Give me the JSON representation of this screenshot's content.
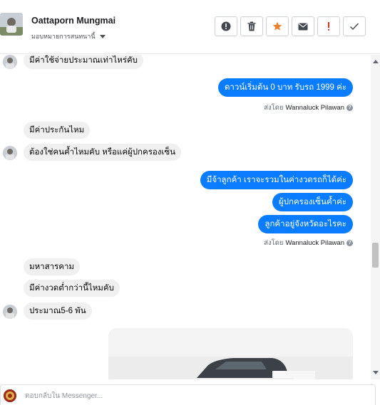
{
  "header": {
    "name": "Oattaporn Mungmai",
    "assign_label": "มอบหมายการสนทนานี้"
  },
  "actions": [
    {
      "icon": "alert-circle-icon"
    },
    {
      "icon": "trash-icon"
    },
    {
      "icon": "star-icon",
      "color": "#e8812d"
    },
    {
      "icon": "envelope-icon"
    },
    {
      "icon": "exclamation-icon",
      "color": "#d93025"
    },
    {
      "icon": "checkmark-icon"
    }
  ],
  "messages": {
    "m1": "มีค่าใช้จ่ายประมาณเท่าไหร่คับ",
    "m2": "ดาวน์เริ่มต้น 0 บาท รับรถ 1999 ค่ะ",
    "sent_prefix": "ส่งโดย",
    "sender": "Wannaluck Pilawan",
    "m3": "มีค่าประกันไหม",
    "m4": "ต้องใช่คนค้ำไหมคับ หรือแค่ผู้ปกครองเซ็น",
    "m5": "มีจ้าลูกค้า  เราจะรวมในค่างวดรถก็ได้ค่ะ",
    "m6": "ผู้ปกครองเซ็นค้ำค่ะ",
    "m7": "ลูกค้าอยู่จังหวัดอะไรคะ",
    "m8": "มหาสารคาม",
    "m9": "มีค่างวดต่ำกว่านี้ไหมคับ",
    "m10": "ประมาณ5-6 พัน"
  },
  "composer": {
    "placeholder": "ตอบกลับใน Messenger..."
  }
}
